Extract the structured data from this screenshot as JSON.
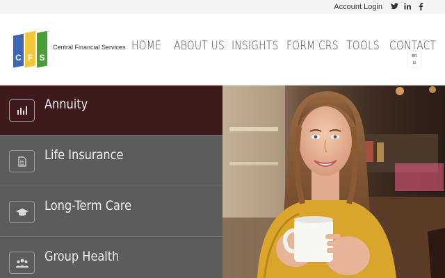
{
  "topbar": {
    "account_login": "Account Login",
    "social_icons": [
      "twitter-icon",
      "linkedin-icon",
      "facebook-icon"
    ]
  },
  "brand": {
    "logo_letters": [
      "C",
      "F",
      "S"
    ],
    "company_name": "Central Financial Services",
    "colors": {
      "blue": "#3a68b4",
      "yellow": "#f2c83a",
      "green": "#4a9e3a"
    }
  },
  "nav": {
    "home": "HOME",
    "about": "ABOUT US",
    "insights": "INSIGHTS",
    "form_crs": "FORM CRS",
    "tools": "TOOLS",
    "contact": "CONTACT",
    "menu_toggle_line1": "en",
    "menu_toggle_line2": "u"
  },
  "sidebar": {
    "items": [
      {
        "label": "Annuity",
        "icon": "bar-chart-icon",
        "active": true
      },
      {
        "label": "Life Insurance",
        "icon": "document-icon",
        "active": false
      },
      {
        "label": "Long-Term Care",
        "icon": "graduation-cap-icon",
        "active": false
      },
      {
        "label": "Group Health",
        "icon": "group-icon",
        "active": false
      }
    ],
    "active_color": "#3f1a1c",
    "inactive_color": "#5c5c5c"
  },
  "hero": {
    "image": "woman-holding-coffee-cup-photo"
  }
}
